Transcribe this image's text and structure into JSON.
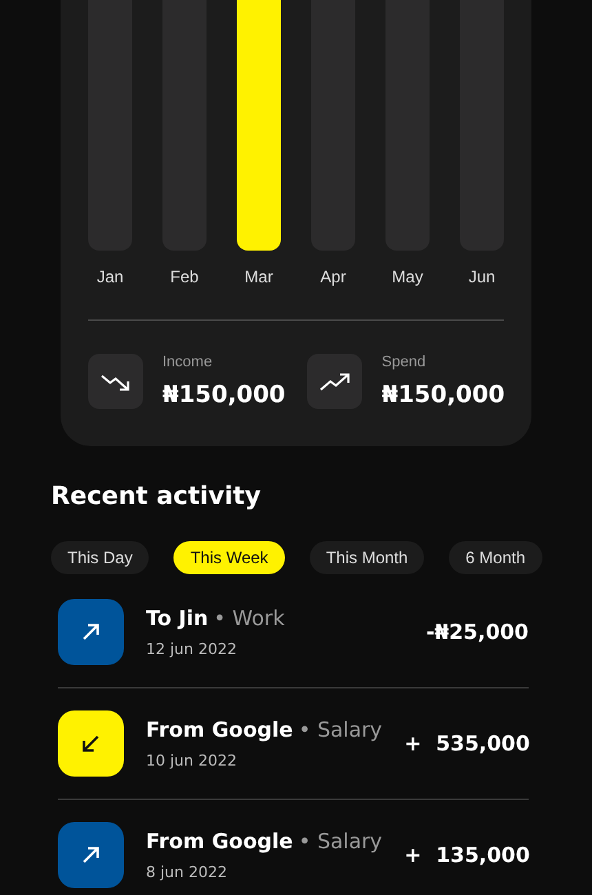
{
  "chart": {
    "months": [
      {
        "label": "Jan",
        "selected": false
      },
      {
        "label": "Feb",
        "selected": false
      },
      {
        "label": "Mar",
        "selected": true
      },
      {
        "label": "Apr",
        "selected": false
      },
      {
        "label": "May",
        "selected": false
      },
      {
        "label": "Jun",
        "selected": false
      }
    ]
  },
  "summary": [
    {
      "kind": "income",
      "label": "Income",
      "amount": "₦150,000"
    },
    {
      "kind": "spend",
      "label": "Spend",
      "amount": "₦150,000"
    }
  ],
  "recent_activity": {
    "title": "Recent activity",
    "filters": [
      {
        "label": "This Day",
        "selected": false
      },
      {
        "label": "This Week",
        "selected": true
      },
      {
        "label": "This Month",
        "selected": false
      },
      {
        "label": "6 Month",
        "selected": false
      }
    ],
    "transactions": [
      {
        "kind": "out",
        "color": "#00549a",
        "name": "To Jin",
        "category": "• Work",
        "date": "12 jun 2022",
        "amount": "-₦25,000"
      },
      {
        "kind": "in",
        "color": "#fff200",
        "name": "From Google",
        "category": "• Salary",
        "date": "10 jun 2022",
        "amount": "+  535,000"
      },
      {
        "kind": "out",
        "color": "#00549a",
        "name": "From Google",
        "category": "• Salary",
        "date": "8 jun 2022",
        "amount": "+  135,000"
      }
    ]
  }
}
